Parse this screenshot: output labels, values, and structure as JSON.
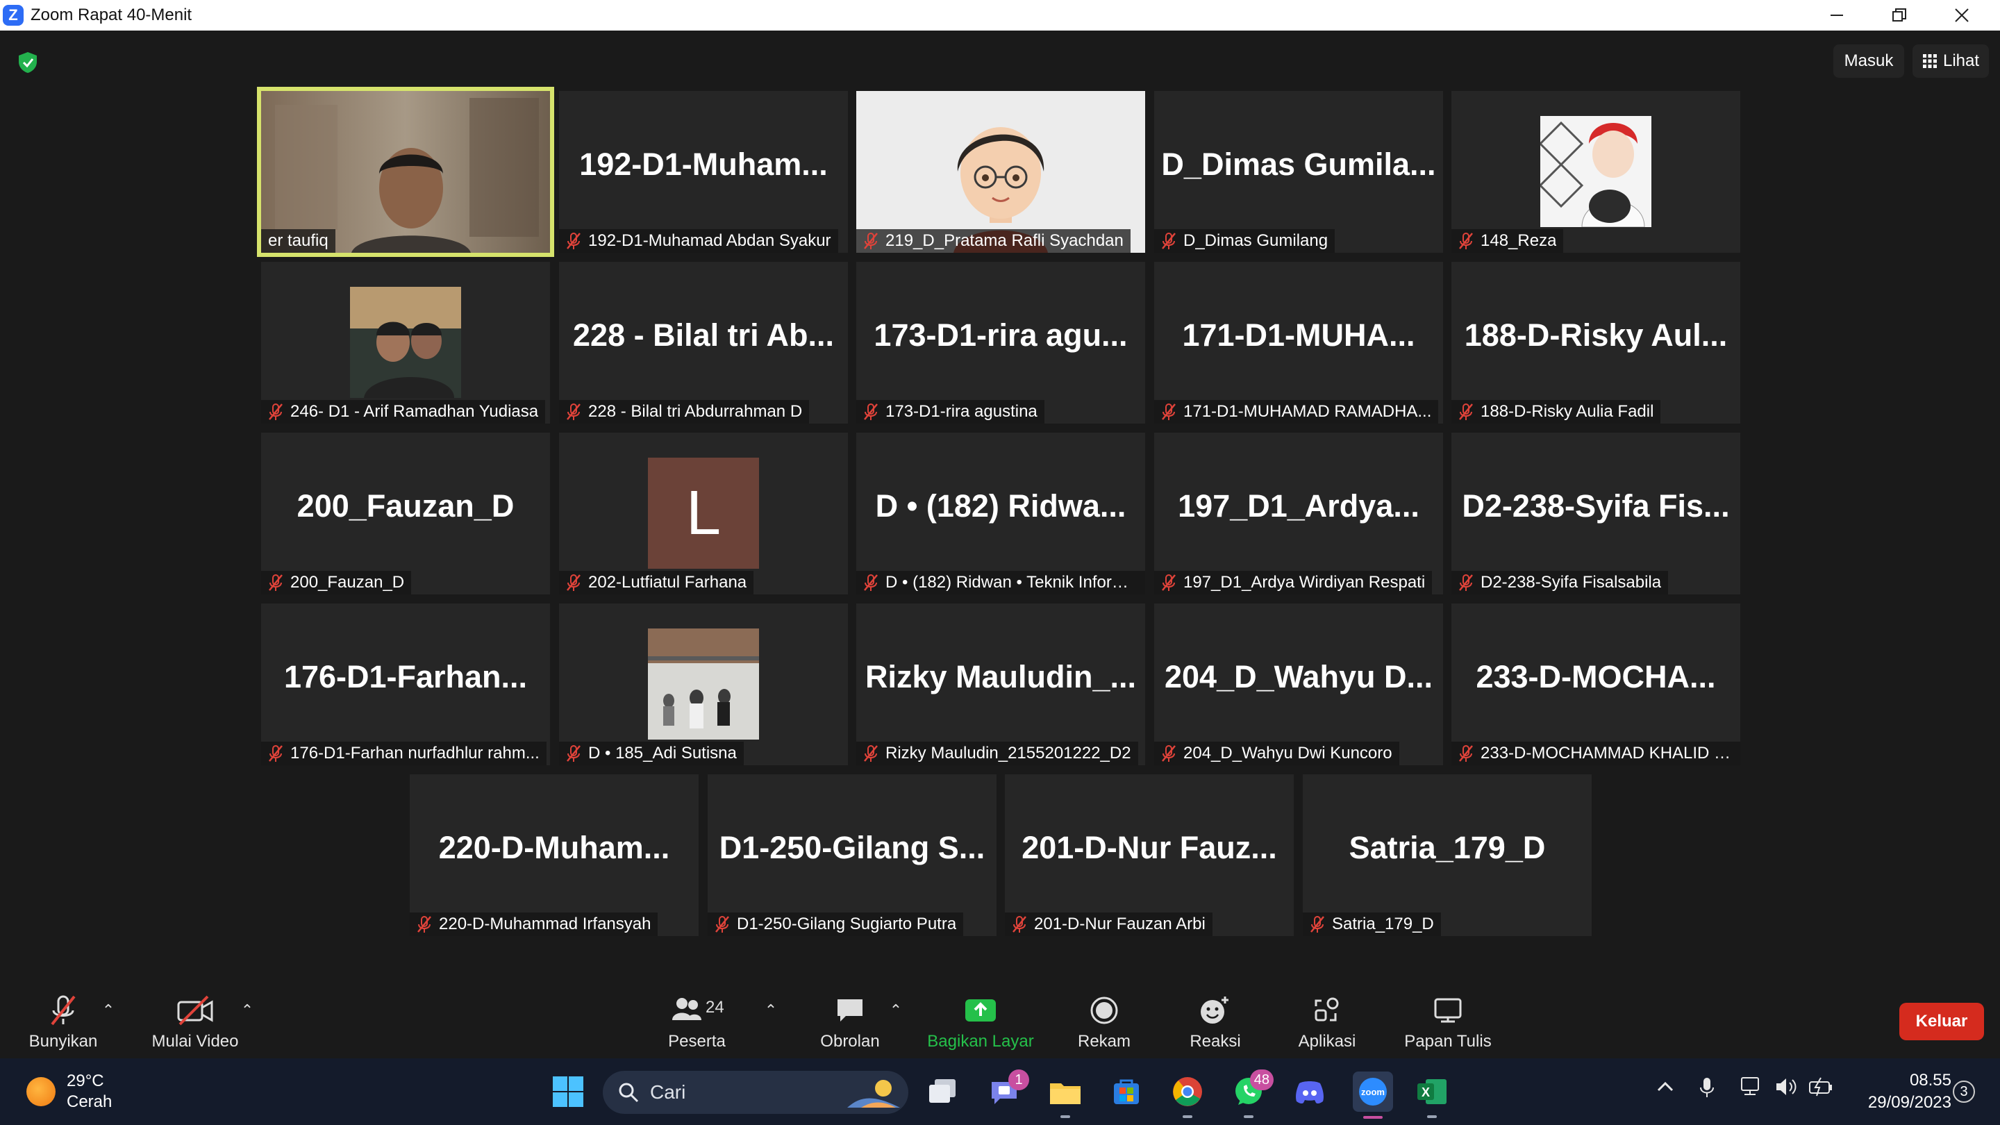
{
  "window": {
    "title": "Zoom Rapat 40-Menit"
  },
  "top_buttons": {
    "masuk": "Masuk",
    "lihat": "Lihat"
  },
  "tiles": [
    {
      "big": "",
      "label": "er taufiq",
      "muted": false,
      "type": "video"
    },
    {
      "big": "192-D1-Muham...",
      "label": "192-D1-Muhamad Abdan Syakur",
      "muted": true,
      "type": "name"
    },
    {
      "big": "",
      "label": "219_D_Pratama Rafli Syachdan",
      "muted": true,
      "type": "avatar"
    },
    {
      "big": "D_Dimas  Gumila...",
      "label": "D_Dimas Gumilang",
      "muted": true,
      "type": "name"
    },
    {
      "big": "",
      "label": "148_Reza",
      "muted": true,
      "type": "photo-anime"
    },
    {
      "big": "",
      "label": "246- D1 - Arif Ramadhan Yudiasa",
      "muted": true,
      "type": "photo-selfie"
    },
    {
      "big": "228  - Bilal tri Ab...",
      "label": "228 - Bilal tri Abdurrahman D",
      "muted": true,
      "type": "name"
    },
    {
      "big": "173-D1-rira  agu...",
      "label": "173-D1-rira agustina",
      "muted": true,
      "type": "name"
    },
    {
      "big": "171-D1-MUHA...",
      "label": "171-D1-MUHAMAD RAMADHA...",
      "muted": true,
      "type": "name"
    },
    {
      "big": "188-D-Risky  Aul...",
      "label": "188-D-Risky Aulia Fadil",
      "muted": true,
      "type": "name"
    },
    {
      "big": "200_Fauzan_D",
      "label": "200_Fauzan_D",
      "muted": true,
      "type": "name"
    },
    {
      "big": "L",
      "label": "202-Lutfiatul Farhana",
      "muted": true,
      "type": "letter"
    },
    {
      "big": "D • (182)  Ridwa...",
      "label": "D • (182) Ridwan • Teknik Inform...",
      "muted": true,
      "type": "name"
    },
    {
      "big": "197_D1_Ardya...",
      "label": "197_D1_Ardya Wirdiyan Respati",
      "muted": true,
      "type": "name"
    },
    {
      "big": "D2-238-Syifa  Fis...",
      "label": "D2-238-Syifa Fisalsabila",
      "muted": true,
      "type": "name"
    },
    {
      "big": "176-D1-Farhan...",
      "label": "176-D1-Farhan nurfadhlur rahm...",
      "muted": true,
      "type": "name"
    },
    {
      "big": "",
      "label": "D • 185_Adi Sutisna",
      "muted": true,
      "type": "photo-hall"
    },
    {
      "big": "Rizky  Mauludin_...",
      "label": "Rizky Mauludin_2155201222_D2",
      "muted": true,
      "type": "name"
    },
    {
      "big": "204_D_Wahyu  D...",
      "label": "204_D_Wahyu Dwi Kuncoro",
      "muted": true,
      "type": "name"
    },
    {
      "big": "233-D-MOCHA...",
      "label": "233-D-MOCHAMMAD KHALID H...",
      "muted": true,
      "type": "name"
    },
    {
      "big": "220-D-Muham...",
      "label": "220-D-Muhammad Irfansyah",
      "muted": true,
      "type": "name"
    },
    {
      "big": "D1-250-Gilang  S...",
      "label": "D1-250-Gilang Sugiarto Putra",
      "muted": true,
      "type": "name"
    },
    {
      "big": "201-D-Nur  Fauz...",
      "label": "201-D-Nur Fauzan Arbi",
      "muted": true,
      "type": "name"
    },
    {
      "big": "Satria_179_D",
      "label": "Satria_179_D",
      "muted": true,
      "type": "name"
    }
  ],
  "toolbar": {
    "unmute": "Bunyikan",
    "start_video": "Mulai Video",
    "participants_count": "24",
    "participants": "Peserta",
    "chat": "Obrolan",
    "share": "Bagikan Layar",
    "record": "Rekam",
    "reactions": "Reaksi",
    "apps": "Aplikasi",
    "whiteboard": "Papan Tulis",
    "leave": "Keluar"
  },
  "taskbar": {
    "temperature": "29°C",
    "weather": "Cerah",
    "search_placeholder": "Cari",
    "teams_badge": "1",
    "whatsapp_badge": "48",
    "time": "08.55",
    "date": "29/09/2023",
    "notifications": "3"
  },
  "colors": {
    "active_speaker": "#d6e36c",
    "share_green": "#25c04a",
    "leave_red": "#d52b1e",
    "muted_icon": "#e0433a"
  }
}
